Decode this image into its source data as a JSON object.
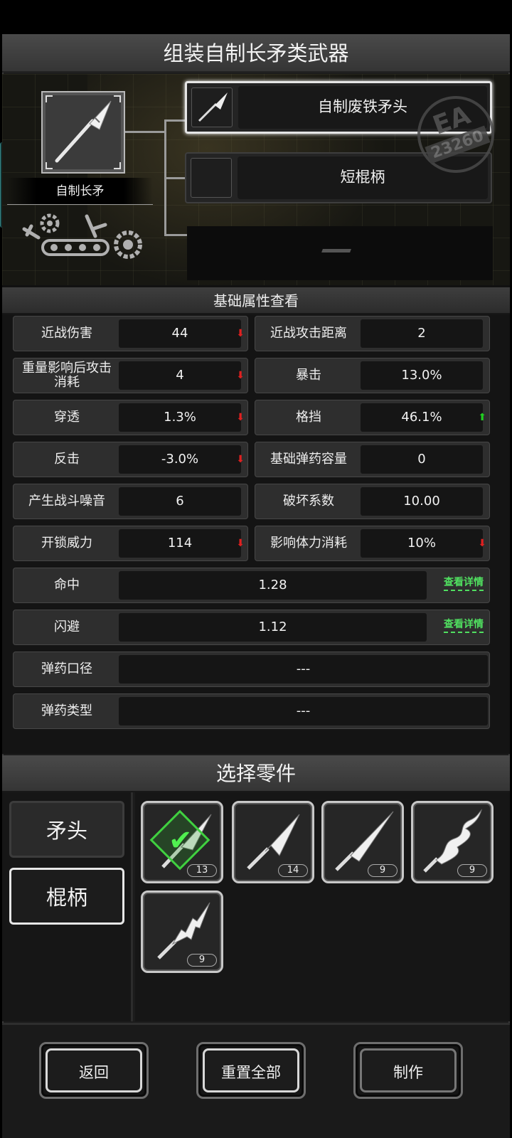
{
  "header": {
    "title": "组装自制长矛类武器"
  },
  "assembly": {
    "weapon_name": "自制长矛",
    "slots": [
      {
        "label": "自制废铁矛头",
        "selected": true
      },
      {
        "label": "短棍柄",
        "selected": false
      },
      {
        "label": "—",
        "selected": false
      }
    ],
    "stamp_ea": "EA",
    "stamp_number": "23260"
  },
  "stats": {
    "section_title": "基础属性查看",
    "rows": [
      {
        "label": "近战伤害",
        "value": "44",
        "arrow": "down"
      },
      {
        "label": "近战攻击距离",
        "value": "2",
        "arrow": ""
      },
      {
        "label": "重量影响后攻击消耗",
        "value": "4",
        "arrow": "down"
      },
      {
        "label": "暴击",
        "value": "13.0%",
        "arrow": ""
      },
      {
        "label": "穿透",
        "value": "1.3%",
        "arrow": "down"
      },
      {
        "label": "格挡",
        "value": "46.1%",
        "arrow": "up"
      },
      {
        "label": "反击",
        "value": "-3.0%",
        "arrow": "down"
      },
      {
        "label": "基础弹药容量",
        "value": "0",
        "arrow": ""
      },
      {
        "label": "产生战斗噪音",
        "value": "6",
        "arrow": ""
      },
      {
        "label": "破坏系数",
        "value": "10.00",
        "arrow": ""
      },
      {
        "label": "开锁威力",
        "value": "114",
        "arrow": "down"
      },
      {
        "label": "影响体力消耗",
        "value": "10%",
        "arrow": "down"
      }
    ],
    "wide_rows": [
      {
        "label": "命中",
        "value": "1.28",
        "link": "查看详情"
      },
      {
        "label": "闪避",
        "value": "1.12",
        "link": "查看详情"
      },
      {
        "label": "弹药口径",
        "value": "---",
        "link": ""
      },
      {
        "label": "弹药类型",
        "value": "---",
        "link": ""
      }
    ],
    "arrow_down_glyph": "⬇",
    "arrow_up_glyph": "⬆"
  },
  "parts": {
    "section_title": "选择零件",
    "categories": [
      {
        "label": "矛头",
        "active": false
      },
      {
        "label": "棍柄",
        "active": true
      }
    ],
    "items": [
      {
        "icon": "spearhead-scrap-icon",
        "count": "13",
        "selected": true
      },
      {
        "icon": "spearhead-broad-icon",
        "count": "14",
        "selected": false
      },
      {
        "icon": "spearhead-thin-icon",
        "count": "9",
        "selected": false
      },
      {
        "icon": "spearhead-wavy-icon",
        "count": "9",
        "selected": false
      },
      {
        "icon": "spearhead-jagged-icon",
        "count": "9",
        "selected": false
      }
    ]
  },
  "footer": {
    "back_label": "返回",
    "reset_label": "重置全部",
    "craft_label": "制作"
  },
  "colors": {
    "accent_green": "#50e060",
    "arrow_red": "#e02020",
    "arrow_green": "#20d020"
  }
}
